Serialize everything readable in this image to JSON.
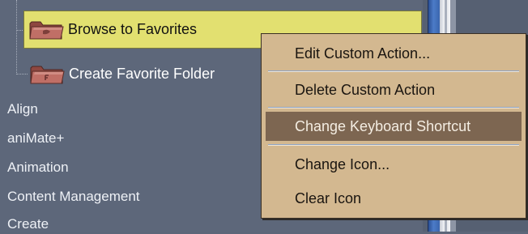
{
  "tree": {
    "folder_items": [
      {
        "label": "Browse to Favorites",
        "icon": "folder-icon",
        "selected": true
      },
      {
        "label": "Create Favorite Folder",
        "icon": "folder-icon",
        "selected": false
      }
    ],
    "categories": [
      "Align",
      "aniMate+",
      "Animation",
      "Content Management",
      "Create"
    ]
  },
  "context_menu": {
    "items": [
      {
        "label": "Edit Custom Action..."
      },
      {
        "label": "Delete Custom Action"
      },
      {
        "label": "Change Keyboard Shortcut",
        "highlighted": true
      },
      {
        "label": "Change Icon..."
      },
      {
        "label": "Clear Icon"
      }
    ]
  },
  "colors": {
    "panel_background": "#5d677a",
    "selection": "#e2e070",
    "menu_background": "#d3b890",
    "menu_highlight": "#7d6651",
    "folder": "#b8635a"
  }
}
